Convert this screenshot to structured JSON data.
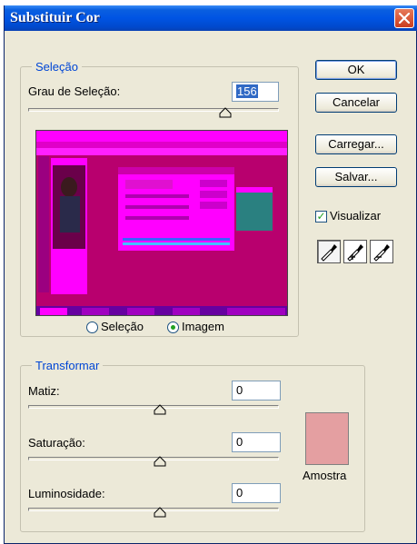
{
  "window": {
    "title": "Substituir Cor"
  },
  "selection_group": {
    "legend": "Seleção",
    "fuzziness_label": "Grau de Seleção:",
    "fuzziness_value": "156",
    "fuzziness_slider_level": 0.78,
    "radio_selection_label": "Seleção",
    "radio_image_label": "Imagem",
    "selected_view": "Imagem"
  },
  "buttons": {
    "ok": "OK",
    "cancel": "Cancelar",
    "load": "Carregar...",
    "save": "Salvar..."
  },
  "preview_checkbox": {
    "label": "Visualizar",
    "checked": true
  },
  "eyedroppers": [
    {
      "name": "eyedropper-icon",
      "active": true
    },
    {
      "name": "eyedropper-plus-icon",
      "active": false
    },
    {
      "name": "eyedropper-minus-icon",
      "active": false
    }
  ],
  "transform_group": {
    "legend": "Transformar",
    "hue_label": "Matiz:",
    "hue_value": "0",
    "hue_slider_level": 0.5,
    "saturation_label": "Saturação:",
    "saturation_value": "0",
    "saturation_slider_level": 0.5,
    "lightness_label": "Luminosidade:",
    "lightness_value": "0",
    "lightness_slider_level": 0.5,
    "sample_label": "Amostra",
    "sample_color": "#e49fa1"
  },
  "colors": {
    "title_bar": "#0054e3",
    "dialog_bg": "#ece9d8",
    "group_legend": "#0046d5",
    "preview_magenta": "#ff00ff",
    "preview_dark": "#b8006e"
  }
}
